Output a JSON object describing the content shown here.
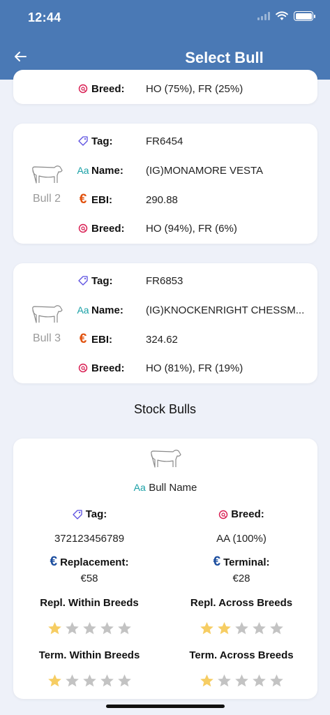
{
  "status_bar": {
    "time": "12:44"
  },
  "header": {
    "title": "Select Bull"
  },
  "labels": {
    "tag": "Tag:",
    "name": "Name:",
    "ebi": "EBI:",
    "breed": "Breed:"
  },
  "partial_card": {
    "breed": "HO (75%), FR (25%)"
  },
  "bulls": [
    {
      "label": "Bull 2",
      "tag": "FR6454",
      "name": "(IG)MONAMORE VESTA",
      "ebi": "290.88",
      "breed": "HO (94%), FR (6%)"
    },
    {
      "label": "Bull 3",
      "tag": "FR6853",
      "name": "(IG)KNOCKENRIGHT CHESSM...",
      "ebi": "324.62",
      "breed": "HO (81%), FR (19%)"
    }
  ],
  "stock_section": {
    "title": "Stock Bulls",
    "bull_name_label": "Bull Name",
    "tag_label": "Tag:",
    "tag_value": "372123456789",
    "breed_label": "Breed:",
    "breed_value": "AA (100%)",
    "replacement_label": "Replacement:",
    "replacement_value": "€58",
    "terminal_label": "Terminal:",
    "terminal_value": "€28",
    "ratings": [
      {
        "label": "Repl. Within Breeds",
        "stars": 1,
        "max": 5
      },
      {
        "label": "Repl. Across Breeds",
        "stars": 2,
        "max": 5
      },
      {
        "label": "Term. Within Breeds",
        "stars": 1,
        "max": 5
      },
      {
        "label": "Term. Across Breeds",
        "stars": 1,
        "max": 5
      }
    ]
  },
  "icons": {
    "back": "arrow-left-icon",
    "tag": "tag-icon",
    "name": "text-aa-icon",
    "ebi": "euro-icon",
    "breed": "breed-icon",
    "bull": "cow-icon",
    "star": "star-icon"
  },
  "colors": {
    "header_bg": "#4a79b5",
    "page_bg": "#eef1f9",
    "euro_orange": "#e1520f",
    "euro_blue": "#1b4d9e",
    "tag_purple": "#5b4fe0",
    "breed_red": "#d81b50",
    "aa_teal": "#19a0a6",
    "star_filled": "#f6cd63",
    "star_empty": "#c3c3c3"
  }
}
